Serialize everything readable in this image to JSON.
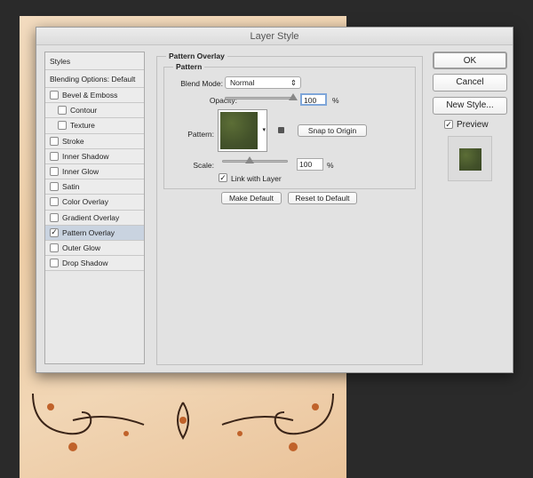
{
  "dialog": {
    "title": "Layer Style"
  },
  "styles_panel": {
    "items": [
      {
        "label": "Styles",
        "type": "head"
      },
      {
        "label": "Blending Options: Default",
        "type": "head"
      },
      {
        "label": "Bevel & Emboss",
        "checked": false
      },
      {
        "label": "Contour",
        "checked": false,
        "sub": true
      },
      {
        "label": "Texture",
        "checked": false,
        "sub": true
      },
      {
        "label": "Stroke",
        "checked": false
      },
      {
        "label": "Inner Shadow",
        "checked": false
      },
      {
        "label": "Inner Glow",
        "checked": false
      },
      {
        "label": "Satin",
        "checked": false
      },
      {
        "label": "Color Overlay",
        "checked": false
      },
      {
        "label": "Gradient Overlay",
        "checked": false
      },
      {
        "label": "Pattern Overlay",
        "checked": true,
        "selected": true
      },
      {
        "label": "Outer Glow",
        "checked": false
      },
      {
        "label": "Drop Shadow",
        "checked": false
      }
    ]
  },
  "pattern_overlay": {
    "section_title": "Pattern Overlay",
    "group_title": "Pattern",
    "blend_mode_label": "Blend Mode:",
    "blend_mode": "Normal",
    "opacity_label": "Opacity:",
    "opacity": "100",
    "opacity_unit": "%",
    "opacity_pct": 100,
    "pattern_label": "Pattern:",
    "snap_label": "Snap to Origin",
    "scale_label": "Scale:",
    "scale": "100",
    "scale_unit": "%",
    "scale_slider_pct": 40,
    "link_label": "Link with Layer",
    "link_checked": true,
    "make_default": "Make Default",
    "reset_default": "Reset to Default",
    "check_glyph": "✓"
  },
  "actions": {
    "ok": "OK",
    "cancel": "Cancel",
    "new_style": "New Style...",
    "preview_label": "Preview",
    "preview_checked": true
  },
  "colors": {
    "selected_row": "#c9d3e0",
    "pattern_green": "#4b5b2e"
  }
}
